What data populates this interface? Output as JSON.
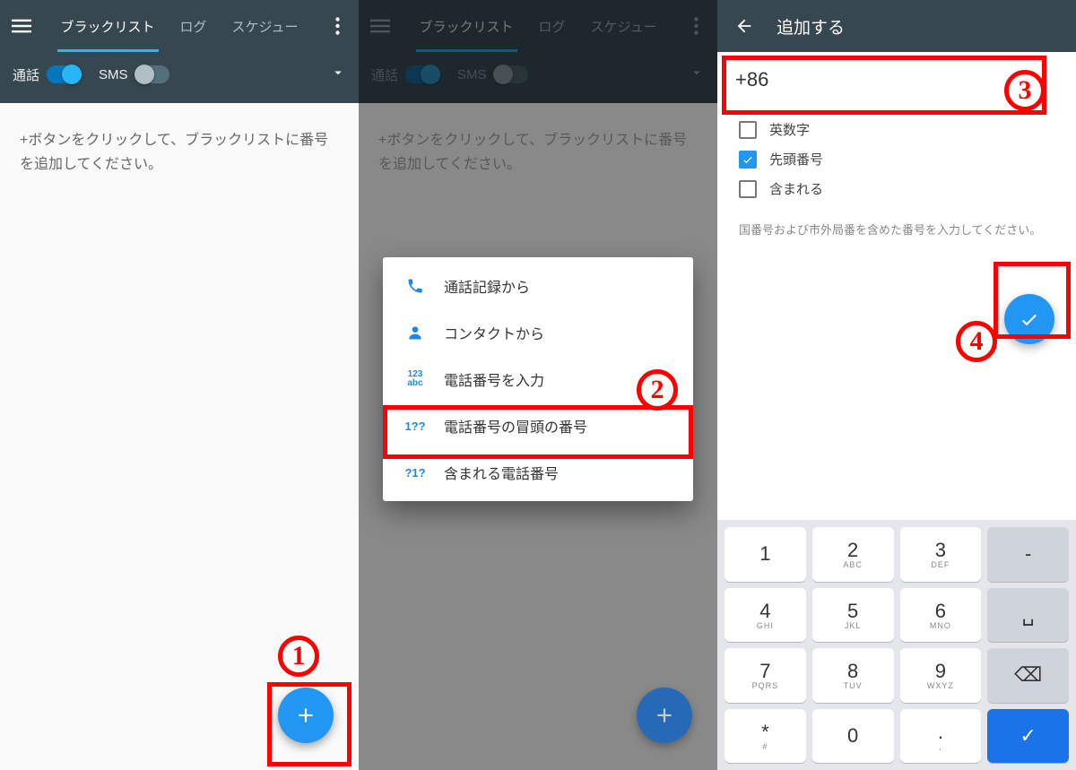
{
  "tabs": {
    "blacklist": "ブラックリスト",
    "log": "ログ",
    "schedule": "スケジュー"
  },
  "toggles": {
    "call": "通話",
    "sms": "SMS"
  },
  "empty_text": "+ボタンをクリックして、ブラックリストに番号を追加してください。",
  "sheet": {
    "from_call_log": "通話記録から",
    "from_contacts": "コンタクトから",
    "enter_number": "電話番号を入力",
    "prefix_number": "電話番号の冒頭の番号",
    "contains_number": "含まれる電話番号",
    "icon_enter": "123\nabc",
    "icon_prefix": "1??",
    "icon_contains": "?1?"
  },
  "add": {
    "title": "追加する",
    "input_value": "+86",
    "opt_alnum": "英数字",
    "opt_prefix": "先頭番号",
    "opt_contains": "含まれる",
    "hint": "国番号および市外局番を含めた番号を入力してください。"
  },
  "keys": [
    [
      {
        "m": "1",
        "s": ""
      },
      {
        "m": "2",
        "s": "ABC"
      },
      {
        "m": "3",
        "s": "DEF"
      },
      {
        "m": "-",
        "s": "",
        "dark": true
      }
    ],
    [
      {
        "m": "4",
        "s": "GHI"
      },
      {
        "m": "5",
        "s": "JKL"
      },
      {
        "m": "6",
        "s": "MNO"
      },
      {
        "m": "␣",
        "s": "",
        "dark": true
      }
    ],
    [
      {
        "m": "7",
        "s": "PQRS"
      },
      {
        "m": "8",
        "s": "TUV"
      },
      {
        "m": "9",
        "s": "WXYZ"
      },
      {
        "m": "⌫",
        "s": "",
        "dark": true
      }
    ],
    [
      {
        "m": "*",
        "s": "#"
      },
      {
        "m": "0",
        "s": ""
      },
      {
        "m": ".",
        "s": ","
      },
      {
        "m": "✓",
        "s": "",
        "blue": true
      }
    ]
  ],
  "callouts": {
    "n1": "1",
    "n2": "2",
    "n3": "3",
    "n4": "4"
  }
}
